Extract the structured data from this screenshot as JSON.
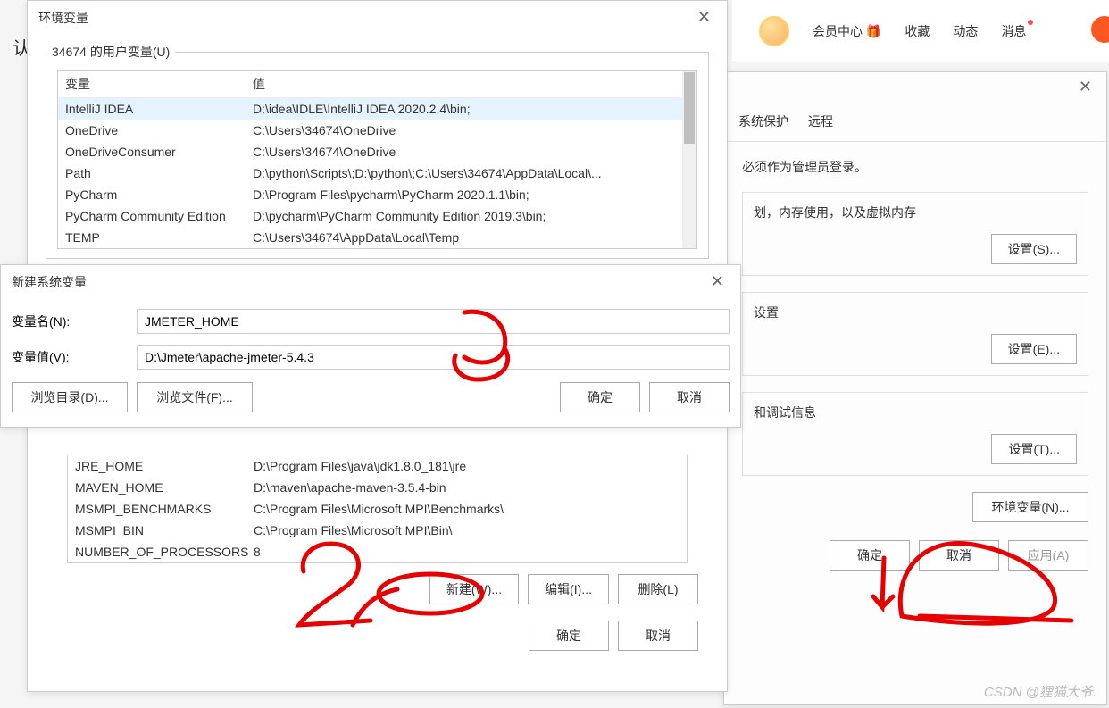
{
  "topbar": {
    "member_center": "会员中心",
    "favorites": "收藏",
    "activity": "动态",
    "messages": "消息"
  },
  "sysprop": {
    "tabs": {
      "protect": "系统保护",
      "remote": "远程"
    },
    "admin_note": "必须作为管理员登录。",
    "perf_note": "划，内存使用，以及虚拟内存",
    "env_note": "设置",
    "debug_note": "和调试信息",
    "btn_settings_s": "设置(S)...",
    "btn_settings_e": "设置(E)...",
    "btn_settings_t": "设置(T)...",
    "btn_envvar": "环境变量(N)...",
    "btn_ok": "确定",
    "btn_cancel": "取消",
    "btn_apply": "应用(A)"
  },
  "envdlg": {
    "title": "环境变量",
    "user_legend": "34674 的用户变量(U)",
    "col_var": "变量",
    "col_val": "值",
    "user_rows": [
      {
        "n": "IntelliJ IDEA",
        "v": "D:\\idea\\IDLE\\IntelliJ IDEA 2020.2.4\\bin;"
      },
      {
        "n": "OneDrive",
        "v": "C:\\Users\\34674\\OneDrive"
      },
      {
        "n": "OneDriveConsumer",
        "v": "C:\\Users\\34674\\OneDrive"
      },
      {
        "n": "Path",
        "v": "D:\\python\\Scripts\\;D:\\python\\;C:\\Users\\34674\\AppData\\Local\\..."
      },
      {
        "n": "PyCharm",
        "v": "D:\\Program Files\\pycharm\\PyCharm 2020.1.1\\bin;"
      },
      {
        "n": "PyCharm Community Edition",
        "v": "D:\\pycharm\\PyCharm Community Edition 2019.3\\bin;"
      },
      {
        "n": "TEMP",
        "v": "C:\\Users\\34674\\AppData\\Local\\Temp"
      }
    ],
    "sys_rows": [
      {
        "n": "JRE_HOME",
        "v": "D:\\Program Files\\java\\jdk1.8.0_181\\jre"
      },
      {
        "n": "MAVEN_HOME",
        "v": "D:\\maven\\apache-maven-3.5.4-bin"
      },
      {
        "n": "MSMPI_BENCHMARKS",
        "v": "C:\\Program Files\\Microsoft MPI\\Benchmarks\\"
      },
      {
        "n": "MSMPI_BIN",
        "v": "C:\\Program Files\\Microsoft MPI\\Bin\\"
      },
      {
        "n": "NUMBER_OF_PROCESSORS",
        "v": "8"
      }
    ],
    "btn_new": "新建(W)...",
    "btn_edit": "编辑(I)...",
    "btn_delete": "删除(L)",
    "btn_ok": "确定",
    "btn_cancel": "取消"
  },
  "newvar": {
    "title": "新建系统变量",
    "name_label": "变量名(N):",
    "name_value": "JMETER_HOME",
    "val_label": "变量值(V):",
    "val_value": "D:\\Jmeter\\apache-jmeter-5.4.3",
    "btn_browse_dir": "浏览目录(D)...",
    "btn_browse_file": "浏览文件(F)...",
    "btn_ok": "确定",
    "btn_cancel": "取消"
  },
  "watermark": "CSDN @狸猫大爷.",
  "page_letter": "认"
}
